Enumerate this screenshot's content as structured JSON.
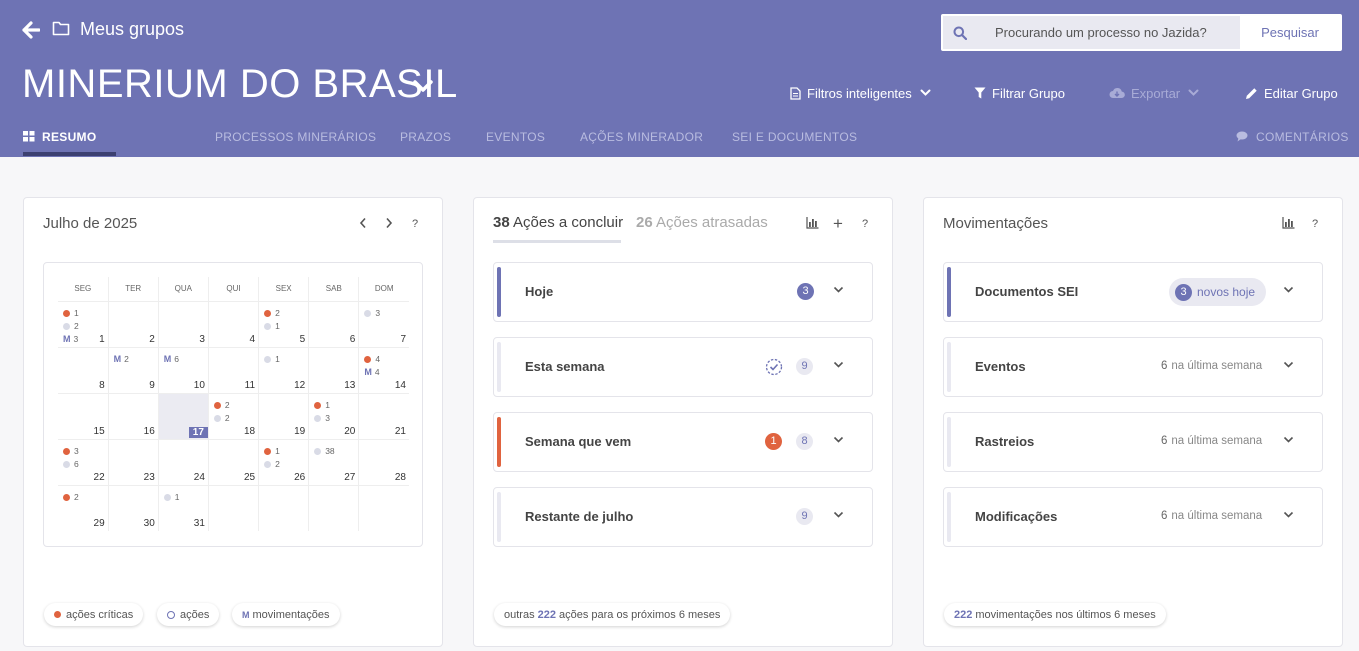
{
  "header": {
    "back_label": "",
    "mygroups": "Meus grupos",
    "group_title": "MINERIUM DO BRASIL",
    "search_placeholder": "Procurando um processo no Jazida?",
    "search_button": "Pesquisar",
    "filtros": "Filtros inteligentes",
    "filtrar": "Filtrar Grupo",
    "exportar": "Exportar",
    "editar": "Editar Grupo",
    "colors": {
      "bar": "#6e73b4",
      "accent_dark": "#3c4071",
      "critical": "#e0633f"
    }
  },
  "tabs": {
    "resumo": "RESUMO",
    "processos": "PROCESSOS MINERÁRIOS",
    "prazos": "PRAZOS",
    "eventos": "EVENTOS",
    "acoes": "AÇÕES MINERADOR",
    "sei": "SEI E DOCUMENTOS",
    "comentarios": "COMENTÁRIOS"
  },
  "calendar": {
    "title": "Julho de 2025",
    "help": "?",
    "weekdays": [
      "SEG",
      "TER",
      "QUA",
      "QUI",
      "SEX",
      "SAB",
      "DOM"
    ],
    "today": 17,
    "weeks": [
      [
        {
          "day": "1",
          "marks": [
            {
              "t": "c",
              "v": "1"
            },
            {
              "t": "a",
              "v": "2"
            },
            {
              "t": "m",
              "v": "3"
            }
          ]
        },
        {
          "day": "2",
          "marks": []
        },
        {
          "day": "3",
          "marks": []
        },
        {
          "day": "4",
          "marks": []
        },
        {
          "day": "5",
          "marks": [
            {
              "t": "c",
              "v": "2"
            },
            {
              "t": "a",
              "v": "1"
            }
          ]
        },
        {
          "day": "6",
          "marks": []
        },
        {
          "day": "7",
          "marks": [
            {
              "t": "a",
              "v": "3"
            }
          ]
        }
      ],
      [
        {
          "day": "8",
          "marks": []
        },
        {
          "day": "9",
          "marks": [
            {
              "t": "m",
              "v": "2"
            }
          ]
        },
        {
          "day": "10",
          "marks": [
            {
              "t": "m",
              "v": "6"
            }
          ]
        },
        {
          "day": "11",
          "marks": []
        },
        {
          "day": "12",
          "marks": [
            {
              "t": "a",
              "v": "1"
            }
          ]
        },
        {
          "day": "13",
          "marks": []
        },
        {
          "day": "14",
          "marks": [
            {
              "t": "c",
              "v": "4"
            },
            {
              "t": "m",
              "v": "4"
            }
          ]
        }
      ],
      [
        {
          "day": "15",
          "marks": []
        },
        {
          "day": "16",
          "marks": []
        },
        {
          "day": "17",
          "marks": []
        },
        {
          "day": "18",
          "marks": [
            {
              "t": "c",
              "v": "2"
            },
            {
              "t": "a",
              "v": "2"
            }
          ]
        },
        {
          "day": "19",
          "marks": []
        },
        {
          "day": "20",
          "marks": [
            {
              "t": "c",
              "v": "1"
            },
            {
              "t": "a",
              "v": "3"
            }
          ]
        },
        {
          "day": "21",
          "marks": []
        }
      ],
      [
        {
          "day": "22",
          "marks": [
            {
              "t": "c",
              "v": "3"
            },
            {
              "t": "a",
              "v": "6"
            }
          ]
        },
        {
          "day": "23",
          "marks": []
        },
        {
          "day": "24",
          "marks": []
        },
        {
          "day": "25",
          "marks": []
        },
        {
          "day": "26",
          "marks": [
            {
              "t": "c",
              "v": "1"
            },
            {
              "t": "a",
              "v": "2"
            }
          ]
        },
        {
          "day": "27",
          "marks": [
            {
              "t": "a",
              "v": "38"
            }
          ]
        },
        {
          "day": "28",
          "marks": []
        }
      ],
      [
        {
          "day": "29",
          "marks": [
            {
              "t": "c",
              "v": "2"
            }
          ]
        },
        {
          "day": "30",
          "marks": []
        },
        {
          "day": "31",
          "marks": [
            {
              "t": "a",
              "v": "1"
            }
          ]
        },
        {
          "day": "",
          "marks": []
        },
        {
          "day": "",
          "marks": []
        },
        {
          "day": "",
          "marks": []
        },
        {
          "day": "",
          "marks": []
        }
      ]
    ],
    "legend": {
      "criticas": "ações críticas",
      "acoes": "ações",
      "mov_letter": "M",
      "movimentacoes": "movimentações"
    }
  },
  "actions": {
    "concluir_count": "38",
    "concluir_label": "Ações a concluir",
    "atrasadas_count": "26",
    "atrasadas_label": "Ações atrasadas",
    "plus": "+",
    "help": "?",
    "rows": [
      {
        "label": "Hoje",
        "badge": "3"
      },
      {
        "label": "Esta semana",
        "badge": "9"
      },
      {
        "label": "Semana que vem",
        "critical": "1",
        "badge": "8"
      },
      {
        "label": "Restante de julho",
        "badge": "9"
      }
    ],
    "footer_prefix": "outras",
    "footer_count": "222",
    "footer_suffix": "ações para os próximos 6 meses"
  },
  "movements": {
    "title": "Movimentações",
    "help": "?",
    "rows": [
      {
        "label": "Documentos SEI",
        "badge": "3",
        "badge_text": "novos hoje"
      },
      {
        "label": "Eventos",
        "count": "6",
        "text": "na última semana"
      },
      {
        "label": "Rastreios",
        "count": "6",
        "text": "na última semana"
      },
      {
        "label": "Modificações",
        "count": "6",
        "text": "na última semana"
      }
    ],
    "footer_count": "222",
    "footer_text": "movimentações nos últimos 6 meses"
  }
}
